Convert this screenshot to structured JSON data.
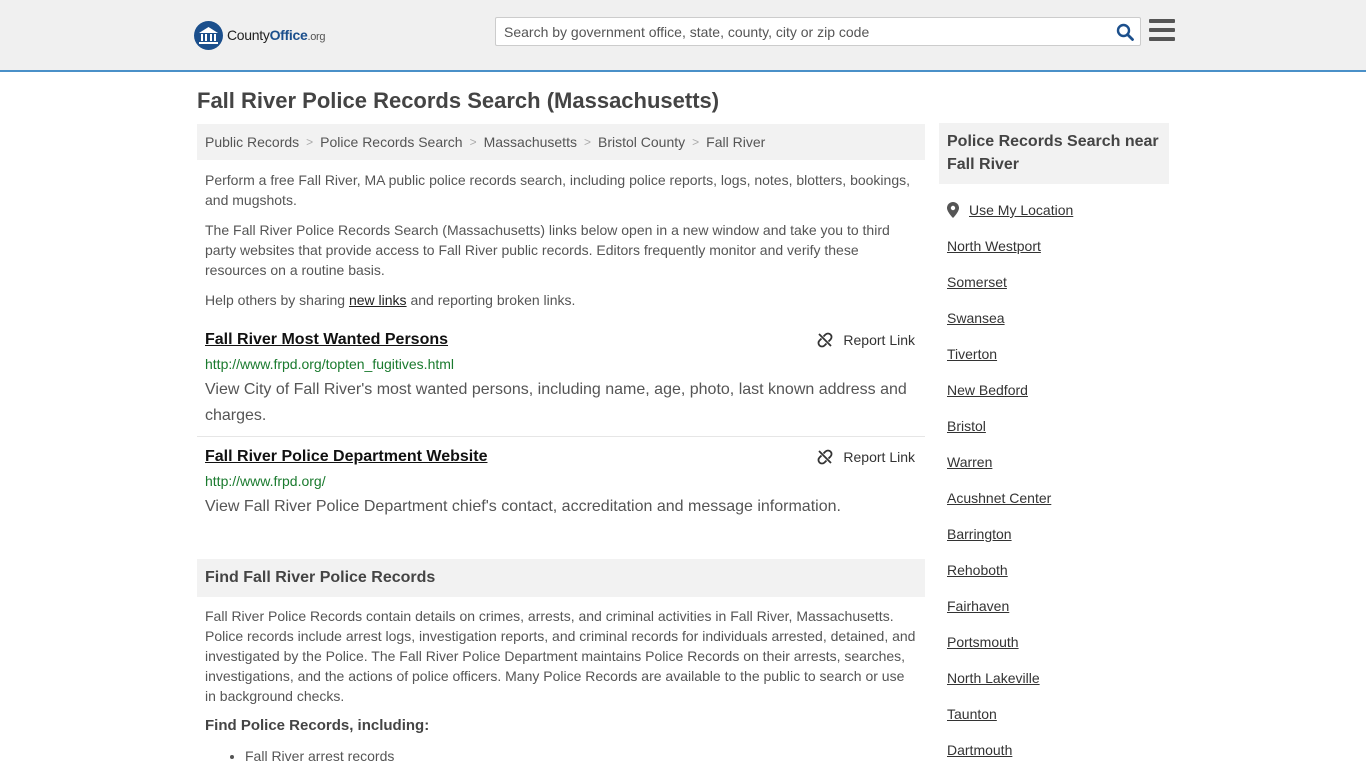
{
  "header": {
    "logo_main": "County",
    "logo_office": "Office",
    "logo_org": ".org",
    "search_placeholder": "Search by government office, state, county, city or zip code"
  },
  "page_title": "Fall River Police Records Search (Massachusetts)",
  "breadcrumb": [
    "Public Records",
    "Police Records Search",
    "Massachusetts",
    "Bristol County",
    "Fall River"
  ],
  "intro": {
    "p1": "Perform a free Fall River, MA public police records search, including police reports, logs, notes, blotters, bookings, and mugshots.",
    "p2": "The Fall River Police Records Search (Massachusetts) links below open in a new window and take you to third party websites that provide access to Fall River public records. Editors frequently monitor and verify these resources on a routine basis.",
    "p3_before": "Help others by sharing ",
    "p3_link": "new links",
    "p3_after": " and reporting broken links."
  },
  "results": [
    {
      "title": "Fall River Most Wanted Persons",
      "url": "http://www.frpd.org/topten_fugitives.html",
      "desc": "View City of Fall River's most wanted persons, including name, age, photo, last known address and charges.",
      "report": "Report Link"
    },
    {
      "title": "Fall River Police Department Website",
      "url": "http://www.frpd.org/",
      "desc": "View Fall River Police Department chief's contact, accreditation and message information.",
      "report": "Report Link"
    }
  ],
  "find_section": {
    "heading": "Find Fall River Police Records",
    "text": "Fall River Police Records contain details on crimes, arrests, and criminal activities in Fall River, Massachusetts. Police records include arrest logs, investigation reports, and criminal records for individuals arrested, detained, and investigated by the Police. The Fall River Police Department maintains Police Records on their arrests, searches, investigations, and the actions of police officers. Many Police Records are available to the public to search or use in background checks.",
    "sub_heading": "Find Police Records, including:",
    "bullets": [
      "Fall River arrest records"
    ]
  },
  "sidebar": {
    "heading": "Police Records Search near Fall River",
    "use_location": "Use My Location",
    "links": [
      "North Westport",
      "Somerset",
      "Swansea",
      "Tiverton",
      "New Bedford",
      "Bristol",
      "Warren",
      "Acushnet Center",
      "Barrington",
      "Rehoboth",
      "Fairhaven",
      "Portsmouth",
      "North Lakeville",
      "Taunton",
      "Dartmouth"
    ]
  },
  "colors": {
    "brand_blue": "#1b4f8c",
    "header_border": "#4a90c8",
    "url_green": "#1a7a2e"
  }
}
